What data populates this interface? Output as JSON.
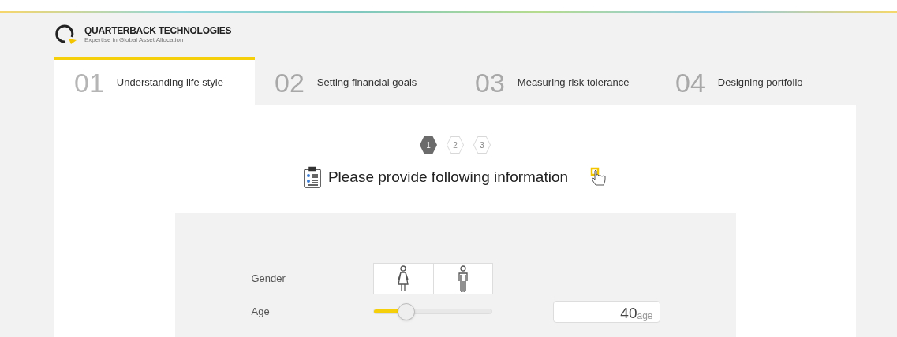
{
  "brand": {
    "name": "QUARTERBACK TECHNOLOGIES",
    "tagline": "Expertise in Global Asset Allocation"
  },
  "tabs": [
    {
      "number": "01",
      "label": "Understanding life style",
      "selected": true
    },
    {
      "number": "02",
      "label": "Setting financial goals",
      "selected": false
    },
    {
      "number": "03",
      "label": "Measuring risk tolerance",
      "selected": false
    },
    {
      "number": "04",
      "label": "Designing portfolio",
      "selected": false
    }
  ],
  "steps": [
    {
      "label": "1",
      "selected": true
    },
    {
      "label": "2",
      "selected": false
    },
    {
      "label": "3",
      "selected": false
    }
  ],
  "heading": "Please provide following information",
  "form": {
    "gender": {
      "label": "Gender",
      "options": [
        {
          "kind": "female",
          "selected": false
        },
        {
          "kind": "male",
          "selected": false
        }
      ]
    },
    "age": {
      "label": "Age",
      "level": 0.28,
      "value": "40",
      "unit": "age"
    }
  }
}
